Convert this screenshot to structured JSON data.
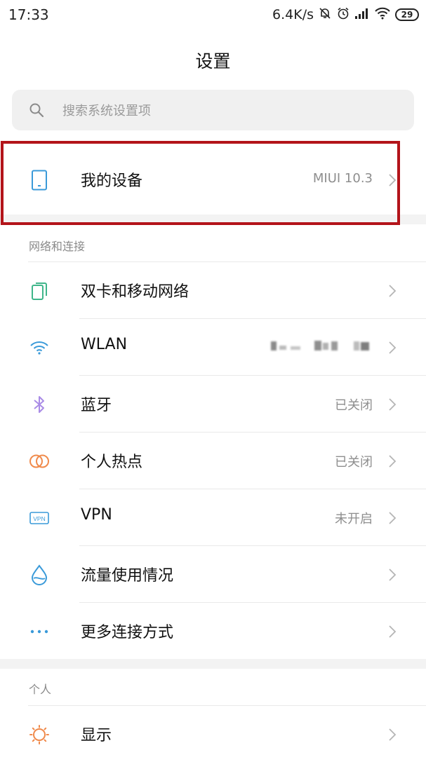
{
  "status_bar": {
    "time": "17:33",
    "network_speed": "6.4K/s",
    "battery_level": "29",
    "icons": [
      "mute-icon",
      "alarm-icon",
      "signal-icon",
      "wifi-icon",
      "battery-icon"
    ]
  },
  "page": {
    "title": "设置"
  },
  "search": {
    "placeholder": "搜索系统设置项"
  },
  "my_device": {
    "label": "我的设备",
    "value": "MIUI 10.3",
    "icon": "phone-icon"
  },
  "sections": {
    "network": {
      "header": "网络和连接",
      "items": [
        {
          "label": "双卡和移动网络",
          "value": "",
          "icon": "dual-sim-icon"
        },
        {
          "label": "WLAN",
          "value": "",
          "icon": "wifi-icon"
        },
        {
          "label": "蓝牙",
          "value": "已关闭",
          "icon": "bluetooth-icon"
        },
        {
          "label": "个人热点",
          "value": "已关闭",
          "icon": "hotspot-icon"
        },
        {
          "label": "VPN",
          "value": "未开启",
          "icon": "vpn-icon"
        },
        {
          "label": "流量使用情况",
          "value": "",
          "icon": "data-usage-icon"
        },
        {
          "label": "更多连接方式",
          "value": "",
          "icon": "more-icon"
        }
      ]
    },
    "personal": {
      "header": "个人",
      "items": [
        {
          "label": "显示",
          "value": "",
          "icon": "brightness-icon"
        }
      ]
    }
  },
  "colors": {
    "highlight_box": "#b3141a",
    "icon_blue": "#3a9ad9",
    "icon_green": "#3fb58a",
    "icon_purple": "#a98be6",
    "icon_orange": "#f08a4b"
  }
}
